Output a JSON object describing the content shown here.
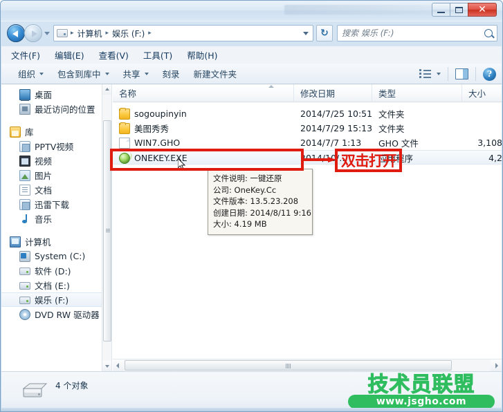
{
  "window": {
    "minimize_label": "最小化",
    "maximize_label": "最大化",
    "close_label": "✕"
  },
  "addressbar": {
    "back_label": "后退",
    "forward_label": "前进",
    "recent_label": "最近浏览的位置",
    "crumbs": [
      "计算机",
      "娱乐 (F:)"
    ],
    "separator": "▸",
    "refresh_label": "↻"
  },
  "search": {
    "placeholder": "搜索 娱乐 (F:)",
    "value": ""
  },
  "menubar": {
    "items": [
      {
        "label": "文件(F)"
      },
      {
        "label": "编辑(E)"
      },
      {
        "label": "查看(V)"
      },
      {
        "label": "工具(T)"
      },
      {
        "label": "帮助(H)"
      }
    ]
  },
  "toolbar": {
    "items": [
      {
        "label": "组织",
        "caret": true
      },
      {
        "label": "包含到库中",
        "caret": true
      },
      {
        "label": "共享",
        "caret": true
      },
      {
        "label": "刻录",
        "caret": false
      },
      {
        "label": "新建文件夹",
        "caret": false
      }
    ],
    "views_label": "更改您的视图",
    "preview_label": "显示预览窗格",
    "help_label": "?"
  },
  "navpane": {
    "items": [
      {
        "label": "桌面",
        "icon": "desktop-icon",
        "level": 1,
        "selected": false
      },
      {
        "label": "最近访问的位置",
        "icon": "recent-places-icon",
        "level": 1,
        "selected": false
      },
      {
        "label": "库",
        "icon": "library-icon",
        "level": 0,
        "selected": false
      },
      {
        "label": "PPTV视频",
        "icon": "library-folder-icon",
        "level": 1,
        "selected": false
      },
      {
        "label": "视频",
        "icon": "video-library-icon",
        "level": 1,
        "selected": false
      },
      {
        "label": "图片",
        "icon": "pictures-library-icon",
        "level": 1,
        "selected": false
      },
      {
        "label": "文档",
        "icon": "documents-library-icon",
        "level": 1,
        "selected": false
      },
      {
        "label": "迅雷下载",
        "icon": "library-folder-icon",
        "level": 1,
        "selected": false
      },
      {
        "label": "音乐",
        "icon": "music-library-icon",
        "level": 1,
        "selected": false
      },
      {
        "label": "计算机",
        "icon": "computer-icon",
        "level": 0,
        "selected": false
      },
      {
        "label": "System (C:)",
        "icon": "system-drive-icon",
        "level": 1,
        "selected": false
      },
      {
        "label": "软件 (D:)",
        "icon": "drive-icon",
        "level": 1,
        "selected": false
      },
      {
        "label": "文档 (E:)",
        "icon": "drive-icon",
        "level": 1,
        "selected": false
      },
      {
        "label": "娱乐 (F:)",
        "icon": "drive-icon",
        "level": 1,
        "selected": true
      },
      {
        "label": "DVD RW 驱动器",
        "icon": "dvd-drive-icon",
        "level": 1,
        "selected": false
      }
    ]
  },
  "filelist": {
    "columns": [
      {
        "label": "名称"
      },
      {
        "label": "修改日期"
      },
      {
        "label": "类型"
      },
      {
        "label": "大小"
      }
    ],
    "rows": [
      {
        "name": "sogoupinyin",
        "icon": "folder-icon",
        "date": "2014/7/25 10:51",
        "type": "文件夹",
        "size": "",
        "selected": false
      },
      {
        "name": "美图秀秀",
        "icon": "folder-icon",
        "date": "2014/7/29 15:13",
        "type": "文件夹",
        "size": "",
        "selected": false
      },
      {
        "name": "WIN7.GHO",
        "icon": "file-icon",
        "date": "2014/7/7 1:13",
        "type": "GHO 文件",
        "size": "3,108",
        "selected": false
      },
      {
        "name": "ONEKEY.EXE",
        "icon": "onekey-app-icon",
        "date": "2014/10/…",
        "type": "应用程序",
        "size": "4,2",
        "selected": true
      }
    ]
  },
  "tooltip": {
    "lines": [
      "文件说明: 一键还原",
      "公司: OneKey.Cc",
      "文件版本: 13.5.23.208",
      "创建日期: 2014/8/11 9:16",
      "大小: 4.19 MB"
    ]
  },
  "annotation": {
    "callout_text": "双击打开",
    "color": "#e01b10"
  },
  "statusbar": {
    "item_count": "4 个对象",
    "drive_icon": "hard-drive-icon"
  },
  "watermark": {
    "title": "技术员联盟",
    "url": "www.jsgho.com",
    "color": "#2fbd5f"
  }
}
